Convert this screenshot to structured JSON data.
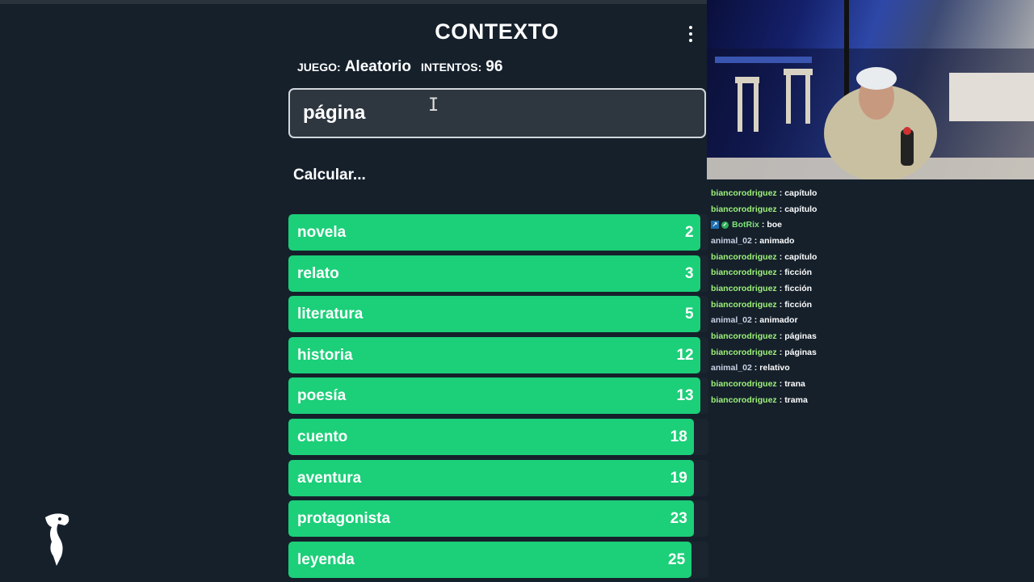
{
  "game": {
    "title": "CONTEXTO",
    "mode_label": "JUEGO:",
    "mode_value": "Aleatorio",
    "attempts_label": "INTENTOS:",
    "attempts_value": "96",
    "input_value": "página",
    "status": "Calcular...",
    "guesses": [
      {
        "word": "novela",
        "rank": "2",
        "closeness": 0.98
      },
      {
        "word": "relato",
        "rank": "3",
        "closeness": 0.98
      },
      {
        "word": "literatura",
        "rank": "5",
        "closeness": 0.98
      },
      {
        "word": "historia",
        "rank": "12",
        "closeness": 0.98
      },
      {
        "word": "poesía",
        "rank": "13",
        "closeness": 0.98
      },
      {
        "word": "cuento",
        "rank": "18",
        "closeness": 0.965
      },
      {
        "word": "aventura",
        "rank": "19",
        "closeness": 0.965
      },
      {
        "word": "protagonista",
        "rank": "23",
        "closeness": 0.965
      },
      {
        "word": "leyenda",
        "rank": "25",
        "closeness": 0.96
      }
    ],
    "colors": {
      "bar_green": "#1ccf79",
      "background": "#15202b",
      "input_bg": "#2e3740"
    }
  },
  "chat": {
    "messages": [
      {
        "user": "biancorodriguez",
        "text": "capítulo",
        "color": "#9ef27a"
      },
      {
        "user": "biancorodriguez",
        "text": "capítulo",
        "color": "#9ef27a"
      },
      {
        "user": "BotRix",
        "text": "boe",
        "color": "#7fe37a",
        "badges": true
      },
      {
        "user": "animal_02",
        "text": "animado",
        "color": "#c9d3e6"
      },
      {
        "user": "biancorodriguez",
        "text": "capítulo",
        "color": "#9ef27a"
      },
      {
        "user": "biancorodriguez",
        "text": "ficción",
        "color": "#9ef27a"
      },
      {
        "user": "biancorodriguez",
        "text": "ficción",
        "color": "#9ef27a"
      },
      {
        "user": "biancorodriguez",
        "text": "ficción",
        "color": "#9ef27a"
      },
      {
        "user": "animal_02",
        "text": "animador",
        "color": "#c9d3e6"
      },
      {
        "user": "biancorodriguez",
        "text": "páginas",
        "color": "#9ef27a"
      },
      {
        "user": "biancorodriguez",
        "text": "páginas",
        "color": "#9ef27a"
      },
      {
        "user": "animal_02",
        "text": "relativo",
        "color": "#c9d3e6"
      },
      {
        "user": "biancorodriguez",
        "text": "trana",
        "color": "#9ef27a"
      },
      {
        "user": "biancorodriguez",
        "text": "trama",
        "color": "#9ef27a"
      }
    ],
    "separator": ":"
  }
}
